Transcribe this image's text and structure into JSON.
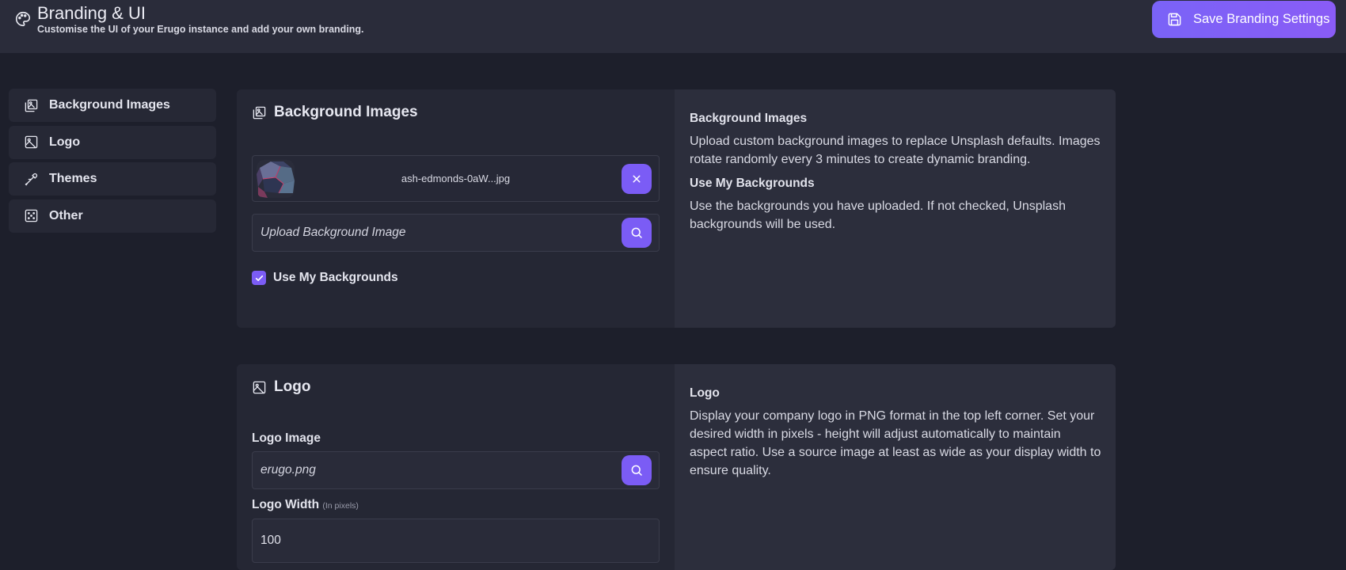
{
  "header": {
    "title": "Branding & UI",
    "subtitle": "Customise the UI of your Erugo instance and add your own branding.",
    "icon": "palette-icon",
    "save_button_label": "Save Branding Settings"
  },
  "sidebar": {
    "items": [
      {
        "label": "Background Images",
        "icon": "images-icon"
      },
      {
        "label": "Logo",
        "icon": "image-icon"
      },
      {
        "label": "Themes",
        "icon": "pipette-icon"
      },
      {
        "label": "Other",
        "icon": "dice-icon"
      }
    ]
  },
  "sections": {
    "background_images": {
      "title": "Background Images",
      "uploaded_file": "ash-edmonds-0aW...jpg",
      "upload_placeholder": "Upload Background Image",
      "use_my_backgrounds_label": "Use My Backgrounds",
      "use_my_backgrounds_checked": true,
      "help": [
        {
          "title": "Background Images",
          "text": "Upload custom background images to replace Unsplash defaults. Images rotate randomly every 3 minutes to create dynamic branding."
        },
        {
          "title": "Use My Backgrounds",
          "text": "Use the backgrounds you have uploaded. If not checked, Unsplash backgrounds will be used."
        }
      ]
    },
    "logo": {
      "title": "Logo",
      "logo_image_label": "Logo Image",
      "logo_image_value": "erugo.png",
      "logo_width_label": "Logo Width",
      "logo_width_hint": "(In pixels)",
      "logo_width_value": "100",
      "help": [
        {
          "title": "Logo",
          "text": "Display your company logo in PNG format in the top left corner. Set your desired width in pixels - height will adjust automatically to maintain aspect ratio. Use a source image at least as wide as your display width to ensure quality."
        }
      ]
    }
  },
  "colors": {
    "accent": "#7b5cf5",
    "background": "#1d1f2b",
    "panel": "#262836"
  }
}
